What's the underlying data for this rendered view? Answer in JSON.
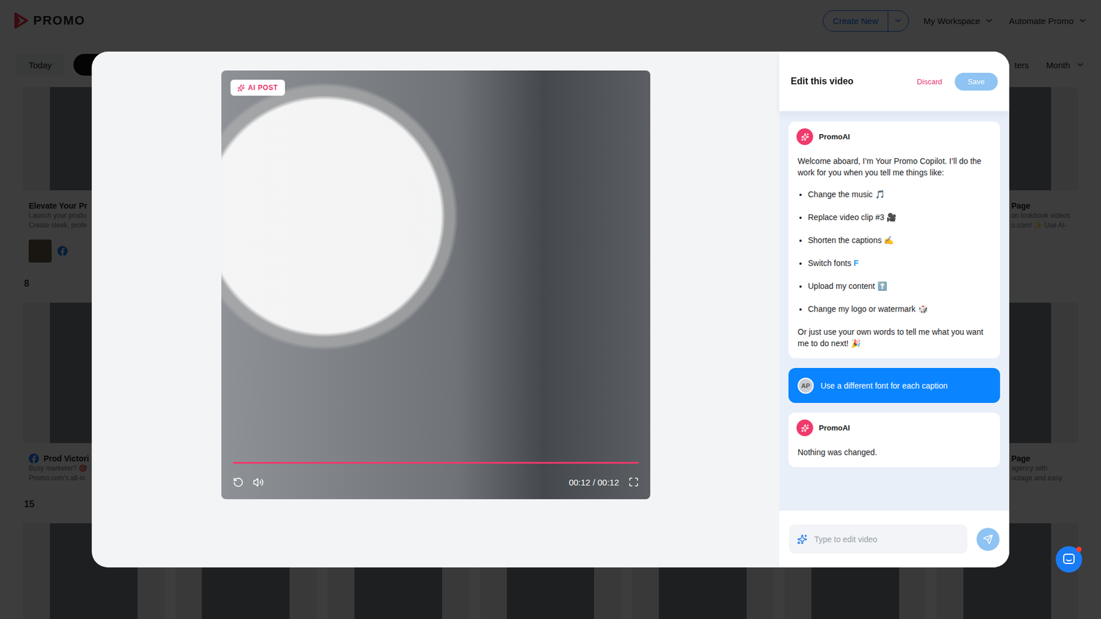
{
  "header": {
    "logo": "PROMO",
    "create": "Create New",
    "menus": [
      "My Workspace",
      "Automate Promo"
    ]
  },
  "toolbar": {
    "today": "Today",
    "filters": "ters",
    "view": "Month"
  },
  "sections": [
    {
      "cards": [
        {
          "kind": "full",
          "title": "Elevate Your Pr",
          "lines": [
            "Launch your produ",
            "Create sleek, profe"
          ]
        },
        {
          "kind": "thumb"
        },
        {
          "kind": "thumb"
        },
        {
          "kind": "thumb"
        },
        {
          "kind": "thumb"
        },
        {
          "kind": "thumb"
        },
        {
          "kind": "text",
          "title": "Page",
          "lines": [
            "on lookbook videos",
            "o.com! ✨ Use AI-"
          ]
        }
      ]
    },
    {
      "day": "8",
      "cards": [
        {
          "kind": "inline",
          "title": "Prod Victori",
          "lines": [
            "Busy marketer? 🎯 :",
            "Promo.com's all-in"
          ]
        },
        {
          "kind": "thumb"
        },
        {
          "kind": "thumb"
        },
        {
          "kind": "thumb"
        },
        {
          "kind": "thumb"
        },
        {
          "kind": "thumb"
        },
        {
          "kind": "text",
          "title": "Page",
          "lines": [
            "agency with",
            "ootage and easy"
          ]
        }
      ]
    },
    {
      "day": "15",
      "cards": [
        {
          "kind": "thumb"
        },
        {
          "kind": "thumb"
        },
        {
          "kind": "thumb"
        },
        {
          "kind": "thumb"
        },
        {
          "kind": "thumb"
        },
        {
          "kind": "thumb"
        },
        {
          "kind": "thumb"
        }
      ]
    }
  ],
  "modal": {
    "badge": "AI POST",
    "player": {
      "time": "00:12 / 00:12",
      "level": 1
    },
    "panel": {
      "title": "Edit this video",
      "discard": "Discard",
      "save": "Save"
    },
    "messages": [
      {
        "kind": "bot",
        "author": "PromoAI",
        "intro": "Welcome aboard, I’m Your Promo Copilot. I’ll do the work for you when you tell me things like:",
        "bullets": [
          {
            "text": "Change the music",
            "emoji": "🎵"
          },
          {
            "text": "Replace video clip #3",
            "emoji": "🎥"
          },
          {
            "text": "Shorten the captions",
            "emoji": "✍️"
          },
          {
            "text": "Switch fonts",
            "emoji": "F"
          },
          {
            "text": "Upload my content",
            "emoji": "⬆️"
          },
          {
            "text": "Change my logo or watermark",
            "emoji": "🎲"
          }
        ],
        "outro": "Or just use your own words to tell me what you want me to do next!",
        "outro_emoji": "🎉"
      },
      {
        "kind": "user",
        "avatar": "AP",
        "text": "Use a different font for each caption"
      },
      {
        "kind": "bot",
        "author": "PromoAI",
        "intro": "Nothing was changed.",
        "bullets": [],
        "outro": "",
        "outro_emoji": ""
      }
    ],
    "input": {
      "placeholder": "Type to edit video"
    }
  }
}
